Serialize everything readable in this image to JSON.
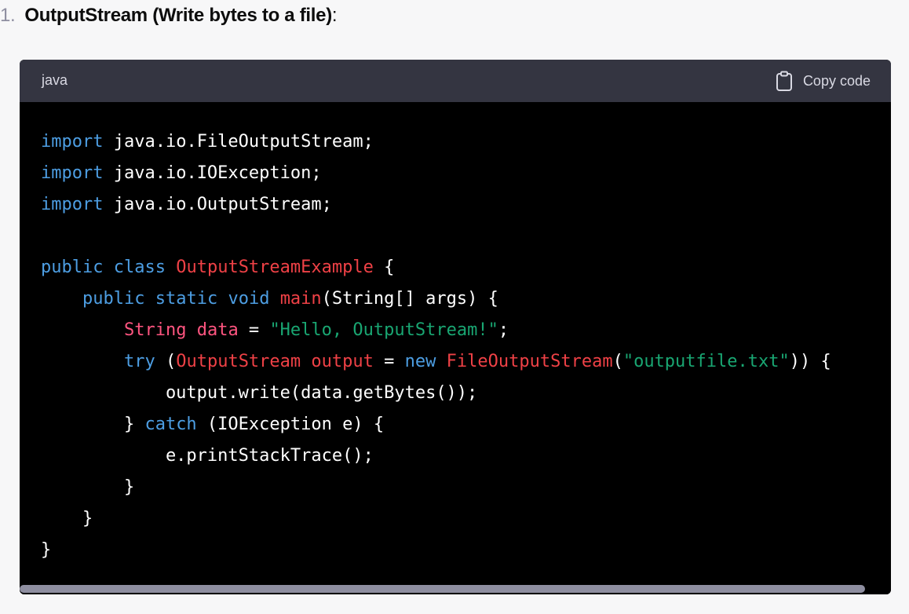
{
  "heading": {
    "number": "1.",
    "title": "OutputStream (Write bytes to a file)",
    "colon": ":"
  },
  "code_block": {
    "language": "java",
    "copy_label": "Copy code",
    "copy_icon": "clipboard-icon",
    "lines": [
      [
        [
          "kw",
          "import"
        ],
        [
          "plain",
          " java.io.FileOutputStream;"
        ]
      ],
      [
        [
          "kw",
          "import"
        ],
        [
          "plain",
          " java.io.IOException;"
        ]
      ],
      [
        [
          "kw",
          "import"
        ],
        [
          "plain",
          " java.io.OutputStream;"
        ]
      ],
      [],
      [
        [
          "kw",
          "public"
        ],
        [
          "plain",
          " "
        ],
        [
          "kw",
          "class"
        ],
        [
          "plain",
          " "
        ],
        [
          "ty",
          "OutputStreamExample"
        ],
        [
          "plain",
          " {"
        ]
      ],
      [
        [
          "plain",
          "    "
        ],
        [
          "kw",
          "public"
        ],
        [
          "plain",
          " "
        ],
        [
          "kw",
          "static"
        ],
        [
          "plain",
          " "
        ],
        [
          "kw",
          "void"
        ],
        [
          "plain",
          " "
        ],
        [
          "ty",
          "main"
        ],
        [
          "plain",
          "(String[] args) {"
        ]
      ],
      [
        [
          "plain",
          "        "
        ],
        [
          "var",
          "String"
        ],
        [
          "plain",
          " "
        ],
        [
          "var",
          "data"
        ],
        [
          "plain",
          " = "
        ],
        [
          "str",
          "\"Hello, OutputStream!\""
        ],
        [
          "plain",
          ";"
        ]
      ],
      [
        [
          "plain",
          "        "
        ],
        [
          "kw",
          "try"
        ],
        [
          "plain",
          " ("
        ],
        [
          "ty",
          "OutputStream"
        ],
        [
          "plain",
          " "
        ],
        [
          "ty",
          "output"
        ],
        [
          "plain",
          " = "
        ],
        [
          "kw",
          "new"
        ],
        [
          "plain",
          " "
        ],
        [
          "ty",
          "FileOutputStream"
        ],
        [
          "plain",
          "("
        ],
        [
          "str",
          "\"outputfile.txt\""
        ],
        [
          "plain",
          ")) {"
        ]
      ],
      [
        [
          "plain",
          "            output.write(data.getBytes());"
        ]
      ],
      [
        [
          "plain",
          "        } "
        ],
        [
          "kw",
          "catch"
        ],
        [
          "plain",
          " (IOException e) {"
        ]
      ],
      [
        [
          "plain",
          "            e.printStackTrace();"
        ]
      ],
      [
        [
          "plain",
          "        }"
        ]
      ],
      [
        [
          "plain",
          "    }"
        ]
      ],
      [
        [
          "plain",
          "}"
        ]
      ]
    ]
  },
  "scrollbar": {
    "horizontal_position": 0,
    "visible_fraction": 0.97
  }
}
